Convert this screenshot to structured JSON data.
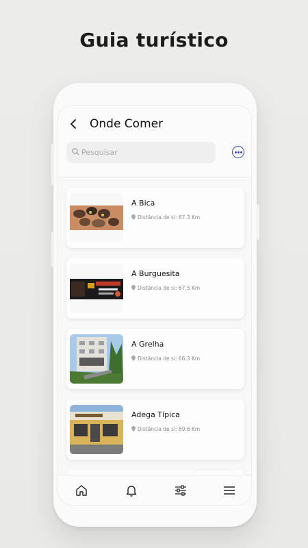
{
  "headline": "Guia turístico",
  "header": {
    "title": "Onde Comer"
  },
  "search": {
    "placeholder": "Pesquisar"
  },
  "restaurants": [
    {
      "name": "A Bica",
      "distance": "Distância de si: 67.3 Km"
    },
    {
      "name": "A Burguesita",
      "distance": "Distância de si: 67.5 Km"
    },
    {
      "name": "A Grelha",
      "distance": "Distância de si: 66.3 Km"
    },
    {
      "name": "Adega Típica",
      "distance": "Distância de si: 69.6 Km"
    }
  ],
  "bottom_nav": [
    "home-icon",
    "bell-icon",
    "filters-icon",
    "menu-icon"
  ],
  "colors": {
    "accent": "#3b4bc8",
    "background": "#ebebe9"
  }
}
